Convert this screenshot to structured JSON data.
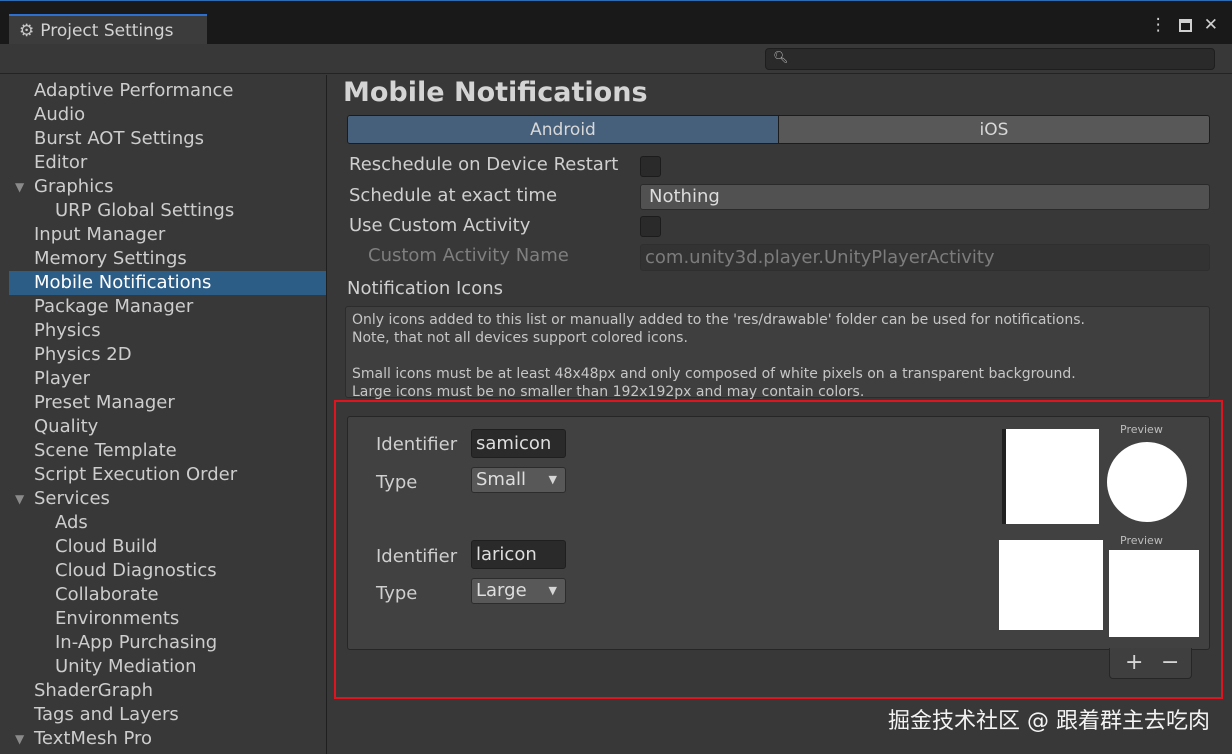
{
  "window": {
    "tab_title": "Project Settings",
    "tab_icon": "gear-icon",
    "controls": {
      "menu": "⋮",
      "maximize": "maximize-icon",
      "close": "✕"
    }
  },
  "search": {
    "icon": "search-icon",
    "placeholder": ""
  },
  "sidebar": {
    "items": [
      {
        "label": "Adaptive Performance"
      },
      {
        "label": "Audio"
      },
      {
        "label": "Burst AOT Settings"
      },
      {
        "label": "Editor"
      },
      {
        "label": "Graphics"
      },
      {
        "label": "URP Global Settings"
      },
      {
        "label": "Input Manager"
      },
      {
        "label": "Memory Settings"
      },
      {
        "label": "Mobile Notifications"
      },
      {
        "label": "Package Manager"
      },
      {
        "label": "Physics"
      },
      {
        "label": "Physics 2D"
      },
      {
        "label": "Player"
      },
      {
        "label": "Preset Manager"
      },
      {
        "label": "Quality"
      },
      {
        "label": "Scene Template"
      },
      {
        "label": "Script Execution Order"
      },
      {
        "label": "Services"
      },
      {
        "label": "Ads"
      },
      {
        "label": "Cloud Build"
      },
      {
        "label": "Cloud Diagnostics"
      },
      {
        "label": "Collaborate"
      },
      {
        "label": "Environments"
      },
      {
        "label": "In-App Purchasing"
      },
      {
        "label": "Unity Mediation"
      },
      {
        "label": "ShaderGraph"
      },
      {
        "label": "Tags and Layers"
      },
      {
        "label": "TextMesh Pro"
      }
    ],
    "selected": "Mobile Notifications"
  },
  "main": {
    "title": "Mobile Notifications",
    "tabs": [
      {
        "label": "Android"
      },
      {
        "label": "iOS"
      }
    ],
    "active_tab": "Android",
    "reschedule_label": "Reschedule on Device Restart",
    "reschedule_checked": false,
    "schedule_label": "Schedule at exact time",
    "schedule_value": "Nothing",
    "custom_activity_label": "Use Custom Activity",
    "custom_activity_checked": false,
    "custom_activity_name_label": "Custom Activity Name",
    "custom_activity_name_value": "com.unity3d.player.UnityPlayerActivity",
    "icons_section_label": "Notification Icons",
    "help_lines": [
      "Only icons added to this list or manually added to the 'res/drawable' folder can be used for notifications.",
      "Note, that not all devices support colored icons.",
      "Small icons must be at least 48x48px and only composed of white pixels on a transparent background.",
      "Large icons must be no smaller than 192x192px and may contain colors."
    ],
    "icons": [
      {
        "identifier_label": "Identifier",
        "identifier": "samicon",
        "type_label": "Type",
        "type": "Small",
        "preview_label": "Preview"
      },
      {
        "identifier_label": "Identifier",
        "identifier": "laricon",
        "type_label": "Type",
        "type": "Large",
        "preview_label": "Preview"
      }
    ],
    "add_label": "+",
    "remove_label": "−"
  },
  "colors": {
    "highlight_frame": "#e0141e",
    "selection": "#2c5d87",
    "active_tab": "#46607c"
  },
  "watermark": "掘金技术社区 @ 跟着群主去吃肉"
}
